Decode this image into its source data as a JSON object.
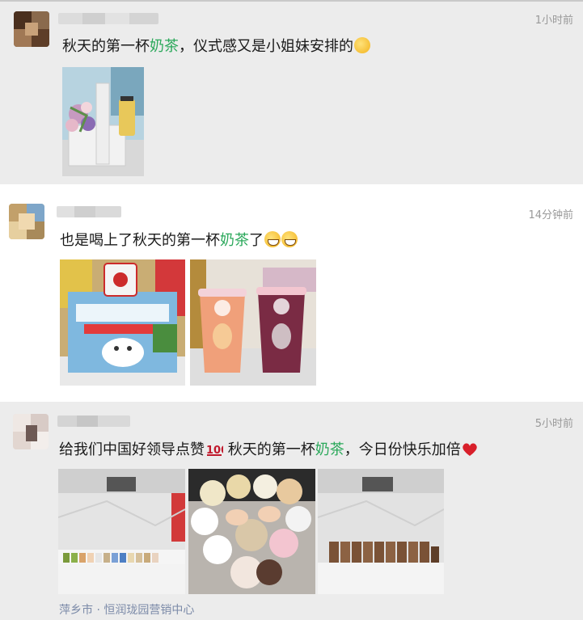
{
  "posts": [
    {
      "time": "1小时前",
      "text_before": "秋天的第一杯",
      "keyword": "奶茶",
      "text_after": "，仪式感又是小姐妹安排的",
      "emoji": "thinking-face-icon"
    },
    {
      "time": "14分钟前",
      "text_before": "也是喝上了秋天的第一杯",
      "keyword": "奶茶",
      "text_after": "了",
      "emoji": "grinning-face-icon"
    },
    {
      "time": "5小时前",
      "text_before": "给我们中国好领导点赞",
      "text_middle": " 秋天的第一杯",
      "keyword": "奶茶",
      "text_after": "，今日份快乐加倍",
      "emoji_1": "hundred-points-icon",
      "emoji_2": "red-heart-icon",
      "location": "萍乡市 · 恒润珑园营销中心"
    }
  ],
  "colors": {
    "keyword": "#2aa85a",
    "time": "#999999",
    "location": "#7b8aa8",
    "post_gray_bg": "#ececec"
  }
}
